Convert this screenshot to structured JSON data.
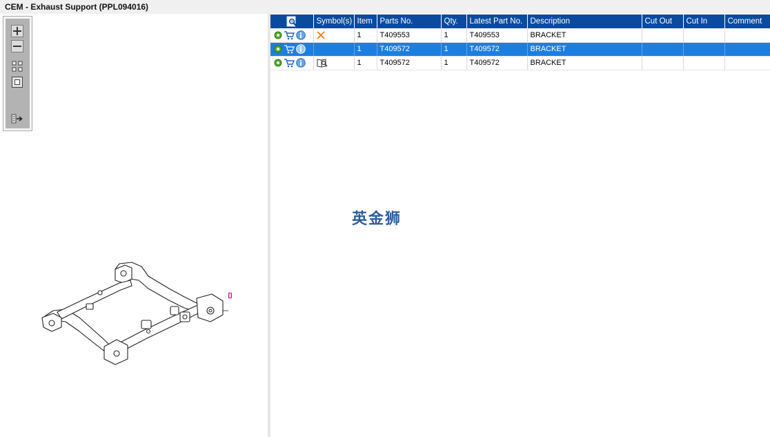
{
  "window": {
    "title": "CEM - Exhaust Support (PPL094016)"
  },
  "viewer": {
    "toolbar": [
      {
        "name": "zoom-in-button",
        "icon": "plus-icon"
      },
      {
        "name": "zoom-out-button",
        "icon": "minus-icon"
      },
      {
        "name": "fit-all-button",
        "icon": "grid-icon"
      },
      {
        "name": "fit-window-button",
        "icon": "square-icon"
      },
      {
        "name": "export-button",
        "icon": "list-arrow-icon"
      }
    ],
    "callout": "1",
    "callout_color": "#e0007a"
  },
  "table": {
    "header_color": "#0a4ba0",
    "selected_color": "#1c7fe0",
    "columns": [
      "",
      "Symbol(s)",
      "Item",
      "Parts No.",
      "Qty.",
      "Latest Part No.",
      "Description",
      "Cut Out",
      "Cut In",
      "Comment"
    ],
    "rows": [
      {
        "symbol": "cross-icon",
        "item": "1",
        "part_no": "T409553",
        "qty": "1",
        "latest_part_no": "T409553",
        "description": "BRACKET",
        "cut_out": "",
        "cut_in": "",
        "comment": "",
        "selected": false
      },
      {
        "symbol": "",
        "item": "1",
        "part_no": "T409572",
        "qty": "1",
        "latest_part_no": "T409572",
        "description": "BRACKET",
        "cut_out": "",
        "cut_in": "",
        "comment": "",
        "selected": true
      },
      {
        "symbol": "book-magnifier-icon",
        "item": "1",
        "part_no": "T409572",
        "qty": "1",
        "latest_part_no": "T409572",
        "description": "BRACKET",
        "cut_out": "",
        "cut_in": "",
        "comment": "",
        "selected": false
      }
    ]
  },
  "watermark": "英金狮"
}
